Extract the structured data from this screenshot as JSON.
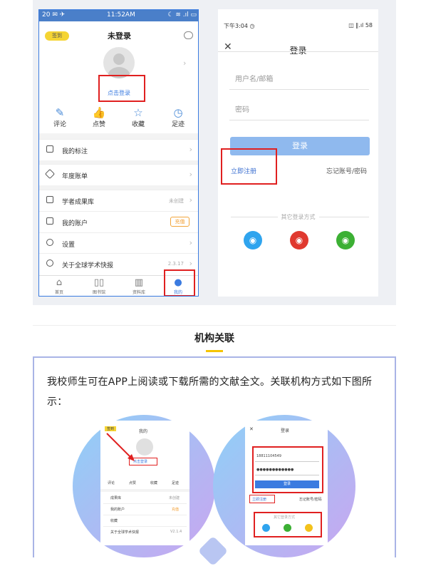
{
  "left_phone": {
    "status": {
      "left": "20 ✉ ✈",
      "time": "11:52AM",
      "right": "☾ ≋ .ıl ▭"
    },
    "signin_badge": "签到",
    "title": "未登录",
    "login_link": "点击登录",
    "quick_actions": [
      {
        "icon": "✎",
        "label": "评论"
      },
      {
        "icon": "👍",
        "label": "点赞"
      },
      {
        "icon": "☆",
        "label": "收藏"
      },
      {
        "icon": "◷",
        "label": "足迹"
      }
    ],
    "rows": {
      "mark": {
        "label": "我的标注"
      },
      "bill": {
        "label": "年度账单"
      },
      "library": {
        "label": "学者成果库",
        "value": "未创建"
      },
      "account": {
        "label": "我的账户",
        "value": "充值"
      },
      "settings": {
        "label": "设置"
      },
      "about": {
        "label": "关于全球学术快报",
        "value": "2.3.17"
      }
    },
    "tabs": [
      {
        "label": "首页"
      },
      {
        "label": "图书馆"
      },
      {
        "label": "资料库"
      },
      {
        "label": "我的"
      }
    ]
  },
  "right_phone": {
    "status": {
      "time": "下午3:04 ◷",
      "right": "◫ ‖.ıl 58"
    },
    "title": "登录",
    "username_placeholder": "用户名/邮箱",
    "password_placeholder": "密码",
    "login_button": "登录",
    "register_link": "立即注册",
    "forgot_link": "忘记账号/密码",
    "other_login": "其它登录方式",
    "socials": [
      {
        "name": "qq",
        "color": "#2fa4ee"
      },
      {
        "name": "weibo",
        "color": "#e0392f"
      },
      {
        "name": "wechat",
        "color": "#3cb034"
      }
    ]
  },
  "section": {
    "title": "机构关联",
    "body": "我校师生可在APP上阅读或下载所需的文献全文。关联机构方式如下图所示："
  },
  "mini_left": {
    "title": "我的",
    "signin_badge": "签到",
    "login_link": "点击登录",
    "quick_actions": [
      "评论",
      "点赞",
      "收藏",
      "足迹"
    ],
    "rows": [
      {
        "label": "成果库",
        "value": "未创建"
      },
      {
        "label": "我的账户",
        "value": "充值"
      },
      {
        "label": "收藏",
        "value": ""
      },
      {
        "label": "关于全球学术快报",
        "value": "V2.1.4"
      }
    ]
  },
  "mini_right": {
    "title": "登录",
    "phone_value": "18811104549",
    "password_value": "●●●●●●●●●●●●",
    "login_button": "登录",
    "register_link": "立即注册",
    "forgot_link": "忘记账号/密码",
    "other_login": "其它登录方式"
  }
}
